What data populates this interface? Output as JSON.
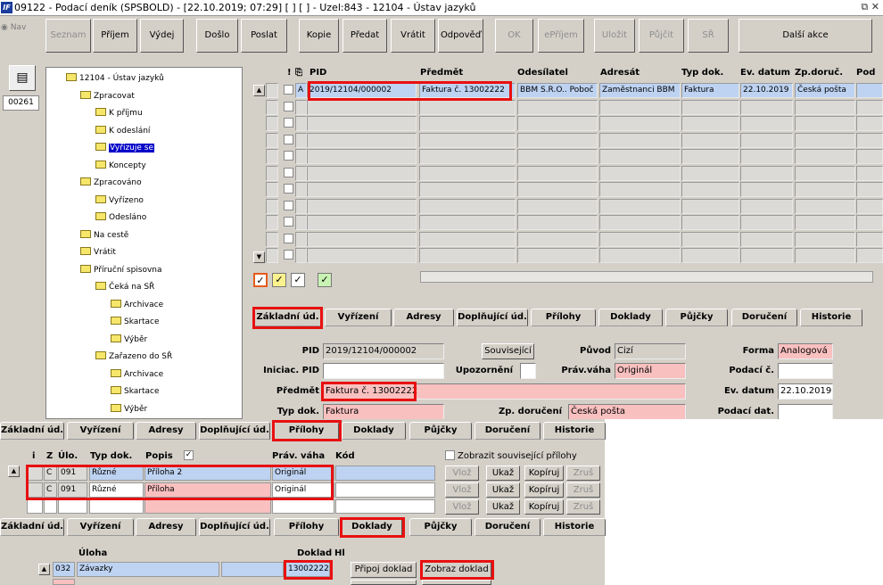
{
  "window": {
    "logo": "IF",
    "title": "09122 - Podací deník (SPSBOLD) - [22.10.2019; 07:29]  [ ]  [ ] - Uzel:843 - 12104 - Ústav jazyků",
    "controls": "⧉ ✕"
  },
  "toolbar": {
    "buttons": [
      {
        "label": "Seznam",
        "enabled": false
      },
      {
        "label": "Příjem",
        "enabled": true
      },
      {
        "label": "Výdej",
        "enabled": true
      },
      {
        "label": "Došlo",
        "enabled": true
      },
      {
        "label": "Poslat",
        "enabled": true
      },
      {
        "label": "Kopie",
        "enabled": true
      },
      {
        "label": "Předat",
        "enabled": true
      },
      {
        "label": "Vrátit",
        "enabled": true
      },
      {
        "label": "Odpověď",
        "enabled": true
      },
      {
        "label": "OK",
        "enabled": false
      },
      {
        "label": "ePříjem",
        "enabled": false
      },
      {
        "label": "Uložit",
        "enabled": false
      },
      {
        "label": "Půjčit",
        "enabled": false
      },
      {
        "label": "SŘ",
        "enabled": false
      },
      {
        "label": "Další akce",
        "enabled": true
      }
    ]
  },
  "nav": {
    "label": "Nav",
    "count": "00261"
  },
  "tree": {
    "nodes": [
      {
        "label": "12104 - Ústav jazyků",
        "level": 0
      },
      {
        "label": "Zpracovat",
        "level": 1
      },
      {
        "label": "K příjmu",
        "level": 2
      },
      {
        "label": "K odeslání",
        "level": 2
      },
      {
        "label": "Vyřizuje se",
        "level": 2,
        "selected": true
      },
      {
        "label": "Koncepty",
        "level": 2
      },
      {
        "label": "Zpracováno",
        "level": 1
      },
      {
        "label": "Vyřízeno",
        "level": 2
      },
      {
        "label": "Odesláno",
        "level": 2
      },
      {
        "label": "Na cestě",
        "level": 1
      },
      {
        "label": "Vrátit",
        "level": 1
      },
      {
        "label": "Příruční spisovna",
        "level": 1
      },
      {
        "label": "Čeká na SŘ",
        "level": 2
      },
      {
        "label": "Archivace",
        "level": 3
      },
      {
        "label": "Skartace",
        "level": 3
      },
      {
        "label": "Výběr",
        "level": 3
      },
      {
        "label": "Zařazeno do SŘ",
        "level": 2
      },
      {
        "label": "Archivace",
        "level": 3
      },
      {
        "label": "Skartace",
        "level": 3
      },
      {
        "label": "Výběr",
        "level": 3
      }
    ]
  },
  "grid": {
    "headers": [
      "!",
      "PID",
      "Předmět",
      "Odesílatel",
      "Adresát",
      "Typ dok.",
      "Ev. datum",
      "Zp.doruč.",
      "Pod"
    ],
    "row": {
      "flag": "A",
      "pid": "2019/12104/000002",
      "predmet": "Faktura č. 13002222",
      "odesilatel": "BBM S.R.O.. Poboč",
      "adresat": "Zaměstnanci BBM",
      "typ": "Faktura",
      "ev_datum": "22.10.2019",
      "zp_doruc": "Česká pošta"
    }
  },
  "tabs": {
    "items": [
      "Základní úd.",
      "Vyřízení",
      "Adresy",
      "Doplňující úd.",
      "Přílohy",
      "Doklady",
      "Půjčky",
      "Doručení",
      "Historie"
    ]
  },
  "form": {
    "pid_label": "PID",
    "pid_value": "2019/12104/000002",
    "souvisejici": "Související",
    "puvod_label": "Původ",
    "puvod_value": "Cizí",
    "forma_label": "Forma",
    "forma_value": "Analogová",
    "iniciac_label": "Iniciac. PID",
    "upozorneni_label": "Upozornění",
    "pravvaha_label": "Práv.váha",
    "pravvaha_value": "Originál",
    "podaci_c_label": "Podací č.",
    "predmet_label": "Předmět",
    "predmet_value": "Faktura č. 13002222",
    "evdatum_label": "Ev. datum",
    "evdatum_value": "22.10.2019 0",
    "typdok_label": "Typ dok.",
    "typdok_value": "Faktura",
    "zpdoruceni_label": "Zp. doručení",
    "zpdoruceni_value": "Česká pošta",
    "podaci_dat_label": "Podací dat."
  },
  "prilohy": {
    "headers": [
      "i",
      "Z",
      "Úlo.",
      "Typ dok.",
      "Popis",
      "Práv. váha",
      "Kód"
    ],
    "show_related_label": "Zobrazit související přílohy",
    "rows": [
      {
        "z": "C",
        "ulo": "091",
        "typ": "Různé",
        "popis": "Příloha 2",
        "vaha": "Originál"
      },
      {
        "z": "C",
        "ulo": "091",
        "typ": "Různé",
        "popis": "Příloha",
        "vaha": "Originál"
      }
    ],
    "row_buttons": [
      "Vlož",
      "Ukaž",
      "Kopíruj",
      "Zruš"
    ]
  },
  "doklady": {
    "uloha_label": "Úloha",
    "doklad_label": "Doklad",
    "hl_label": "Hl",
    "row": {
      "ulo": "032",
      "uloha": "Závazky",
      "doklad": "13002222"
    },
    "pripoj": "Připoj doklad",
    "zobraz": "Zobraz doklad"
  }
}
